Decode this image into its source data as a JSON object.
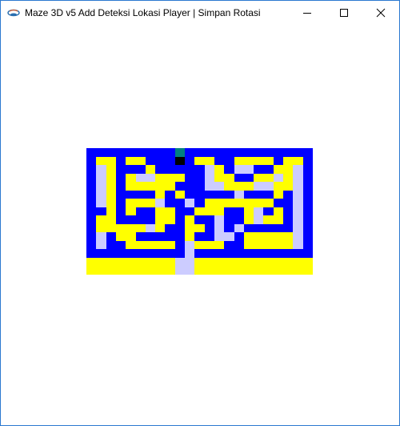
{
  "window": {
    "title": "Maze 3D v5 Add Deteksi Lokasi Player | Simpan Rotasi",
    "icon": "java-cup-icon",
    "controls": [
      "minimize-icon",
      "maximize-icon",
      "close-icon"
    ]
  },
  "maze": {
    "colors": {
      "B": "#0000ff",
      "Y": "#ffff00",
      "L": "#ccccff",
      "T": "#008080",
      "K": "#000000"
    },
    "grid": [
      "BBBBBBBBBTBBBBBBBBBBBBB",
      "BYYBYYBBBKBYYBBYYYYBYYB",
      "BLYBBBYBBBBBLYBLLBBYYLB",
      "BLYBYLLYYYBBLYYBBYYLYLB",
      "BLYBYYYYYBBBLLYYYLLYYLB",
      "BLYBBBBYBYBBBBBLBBBYBLB",
      "BLYBYYYLBBLBYYYYYYYBBLB",
      "BBYBYBBYYBBYYYBBYLBYBLB",
      "BYYBBBBYYBYBBLBBYLYYBLB",
      "BYYYYYLYBBYYBLBLBBBBBLB",
      "BLBYYBBBBBYBBLLBYYYYYLB",
      "BLBBYYYYYBLYYYBBYYYYYLB",
      "BBBBBBBBBBLBBBBBBBBBBBB",
      "YYYYYYYYYLLYYYYYYYYYYYY",
      "YYYYYYYYYLLYYYYYYYYYYYY"
    ]
  }
}
